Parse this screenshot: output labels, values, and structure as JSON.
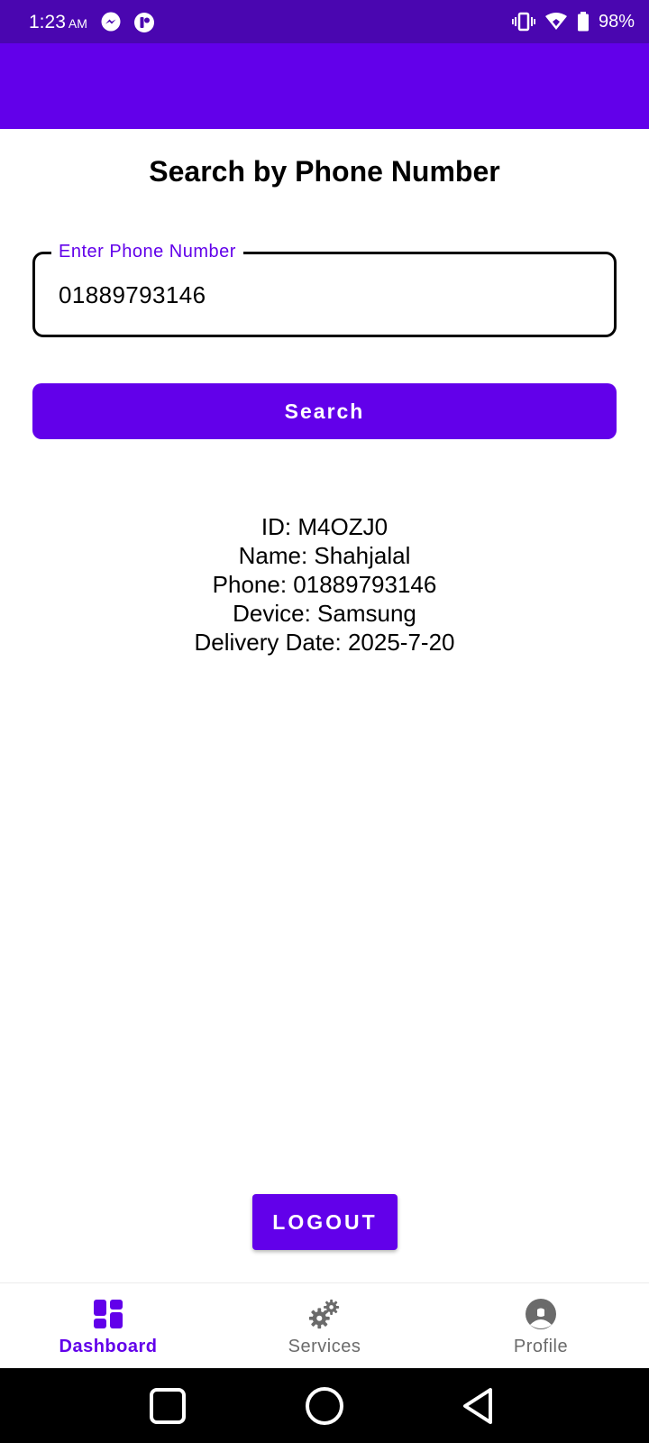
{
  "status_bar": {
    "time": "1:23",
    "ampm": "AM",
    "battery": "98%",
    "icons": [
      "messenger-icon",
      "app-notification-icon",
      "vibrate-icon",
      "wifi-icon",
      "battery-icon"
    ]
  },
  "page": {
    "title": "Search by Phone Number"
  },
  "phone_input": {
    "label": "Enter Phone Number",
    "value": "01889793146"
  },
  "search_button": {
    "label": "Search"
  },
  "result": {
    "id": "ID: M4OZJ0",
    "name": "Name: Shahjalal",
    "phone": "Phone: 01889793146",
    "device": "Device: Samsung",
    "delivery_date": "Delivery Date: 2025-7-20"
  },
  "logout_button": {
    "label": "LOGOUT"
  },
  "bottom_nav": {
    "items": [
      {
        "label": "Dashboard",
        "icon": "dashboard-icon",
        "active": true
      },
      {
        "label": "Services",
        "icon": "gears-icon",
        "active": false
      },
      {
        "label": "Profile",
        "icon": "profile-icon",
        "active": false
      }
    ]
  },
  "colors": {
    "status_bar": "#4a06b0",
    "primary": "#6200ea",
    "inactive": "#6b6b6b"
  }
}
